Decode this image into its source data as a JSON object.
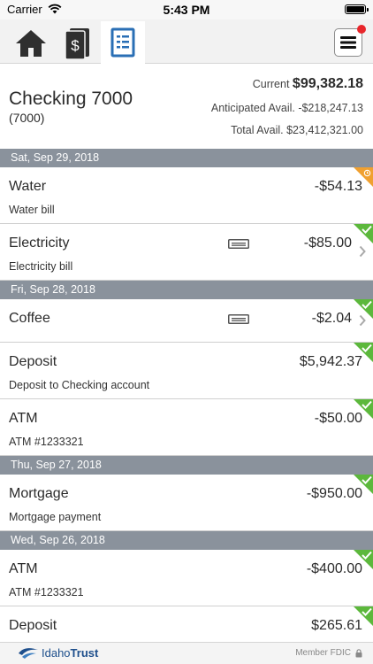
{
  "status_bar": {
    "carrier": "Carrier",
    "time": "5:43 PM"
  },
  "nav": {
    "tabs": [
      {
        "icon": "home-icon"
      },
      {
        "icon": "money-icon"
      },
      {
        "icon": "document-icon",
        "active": true
      }
    ],
    "menu_icon": "hamburger-icon",
    "notification": true
  },
  "account": {
    "name": "Checking 7000",
    "number": "(7000)",
    "current_label": "Current",
    "current_value": "$99,382.18",
    "anticipated": "Anticipated Avail. -$218,247.13",
    "total": "Total Avail. $23,412,321.00"
  },
  "groups": [
    {
      "date": "Sat, Sep 29, 2018",
      "transactions": [
        {
          "title": "Water",
          "subtitle": "Water bill",
          "amount": "-$54.13",
          "status": "pending"
        },
        {
          "title": "Electricity",
          "subtitle": "Electricity bill",
          "amount": "-$85.00",
          "status": "cleared",
          "memo": true,
          "chevron": true
        }
      ]
    },
    {
      "date": "Fri, Sep 28, 2018",
      "transactions": [
        {
          "title": "Coffee",
          "subtitle": "",
          "amount": "-$2.04",
          "status": "cleared",
          "memo": true,
          "chevron": true
        },
        {
          "title": "Deposit",
          "subtitle": "Deposit to Checking account",
          "amount": "$5,942.37",
          "status": "cleared"
        },
        {
          "title": "ATM",
          "subtitle": "ATM #1233321",
          "amount": "-$50.00",
          "status": "cleared"
        }
      ]
    },
    {
      "date": "Thu, Sep 27, 2018",
      "transactions": [
        {
          "title": "Mortgage",
          "subtitle": "Mortgage payment",
          "amount": "-$950.00",
          "status": "cleared"
        }
      ]
    },
    {
      "date": "Wed, Sep 26, 2018",
      "transactions": [
        {
          "title": "ATM",
          "subtitle": "ATM #1233321",
          "amount": "-$400.00",
          "status": "cleared"
        },
        {
          "title": "Deposit",
          "subtitle": "",
          "amount": "$265.61",
          "status": "cleared"
        }
      ]
    }
  ],
  "footer": {
    "brand_light": "Idaho",
    "brand_bold": "Trust",
    "member": "Member FDIC"
  },
  "colors": {
    "header_band": "#8a929c",
    "cleared": "#5cb83c",
    "pending": "#f0a030",
    "brand_blue": "#1e4f8c",
    "active_tab_icon": "#2a6fb5"
  }
}
